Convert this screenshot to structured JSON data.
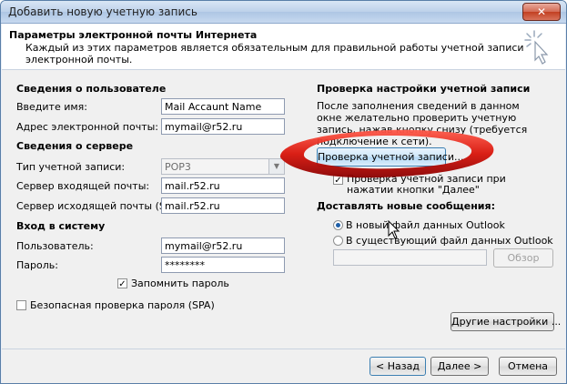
{
  "window": {
    "title": "Добавить новую учетную запись",
    "close_label": "✕"
  },
  "header": {
    "title": "Параметры электронной почты Интернета",
    "description": "Каждый из этих параметров является обязательным для правильной работы учетной записи электронной почты."
  },
  "user_info": {
    "section_title": "Сведения о пользователе",
    "name_label": "Введите имя:",
    "name_value": "Mail Accaunt Name",
    "email_label": "Адрес электронной почты:",
    "email_value": "mymail@r52.ru"
  },
  "server_info": {
    "section_title": "Сведения о сервере",
    "account_type_label": "Тип учетной записи:",
    "account_type_value": "POP3",
    "incoming_label": "Сервер входящей почты:",
    "incoming_value": "mail.r52.ru",
    "outgoing_label": "Сервер исходящей почты (SMTP):",
    "outgoing_value": "mail.r52.ru"
  },
  "logon": {
    "section_title": "Вход в систему",
    "user_label": "Пользователь:",
    "user_value": "mymail@r52.ru",
    "password_label": "Пароль:",
    "password_value": "********",
    "remember_label": "Запомнить пароль",
    "remember_checked": true,
    "spa_label": "Безопасная проверка пароля (SPA)",
    "spa_checked": false
  },
  "test_settings": {
    "section_title": "Проверка настройки учетной записи",
    "description": "После заполнения сведений в данном окне желательно проверить учетную запись, нажав кнопку снизу (требуется подключение к сети).",
    "test_button_label": "Проверка учетной записи...",
    "auto_test_label": "Проверка учетной записи при нажатии кнопки \"Далее\"",
    "auto_test_checked": true
  },
  "delivery": {
    "section_title": "Доставлять новые сообщения:",
    "new_file_label": "В новый файл данных Outlook",
    "existing_file_label": "В существующий файл данных Outlook",
    "browse_label": "Обзор",
    "selected": "new"
  },
  "buttons": {
    "more_settings": "Другие настройки ...",
    "back": "< Назад",
    "next": "Далее >",
    "cancel": "Отмена"
  }
}
